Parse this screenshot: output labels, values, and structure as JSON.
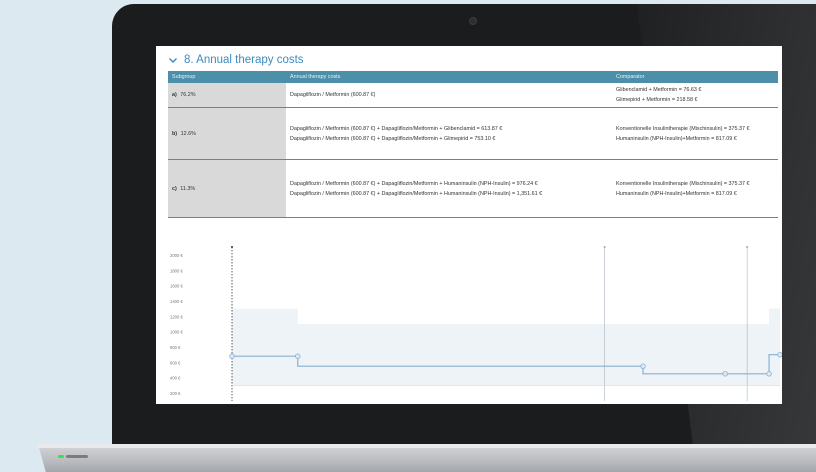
{
  "section": {
    "title": "8. Annual therapy costs",
    "chevron_icon": "chevron-down-icon"
  },
  "table": {
    "headers": [
      "Subgroup",
      "Annual therapy costs",
      "Comparator"
    ],
    "rows": [
      {
        "label": "a)",
        "percent": "76.2%",
        "costs": [
          "Dapagliflozin / Metformin (600.87 €)"
        ],
        "comparator": [
          "Glibenclamid + Metformin = 76.63 €",
          "Glimepirid + Metformin = 218.58 €"
        ]
      },
      {
        "label": "b)",
        "percent": "12.6%",
        "costs": [
          "Dapagliflozin / Metformin (600.87 €) + Dapagliflozin/Metformin + Glibenclamid = 613.87 €",
          "Dapagliflozin / Metformin (600.87 €) + Dapagliflozin/Metformin + Glimepirid = 753.10 €"
        ],
        "comparator": [
          "Konventionelle Insulintherapie (Mischinsulin) = 375.37 €",
          "Humaninsulin (NPH-Insulin)+Metformin = 817.09 €"
        ]
      },
      {
        "label": "c)",
        "percent": "11.3%",
        "costs": [
          "Dapagliflozin / Metformin (600.87 €) + Dapagliflozin/Metformin + Humaninsulin (NPH-Insulin) = 976.24 €",
          "Dapagliflozin / Metformin (600.87 €) + Dapagliflozin/Metformin + Humaninsulin (NPH-Insulin) = 1,351.61 €"
        ],
        "comparator": [
          "Konventionelle Insulintherapie (Mischinsulin) = 375.37 €",
          "Humaninsulin (NPH-Insulin)+Metformin = 817.09 €"
        ]
      }
    ]
  },
  "chart_data": {
    "type": "line",
    "y_ticks": [
      "2000 €",
      "1800 €",
      "1600 €",
      "1400 €",
      "1200 €",
      "1000 €",
      "800 €",
      "600 €",
      "400 €",
      "200 €"
    ],
    "ylim": [
      200,
      2000
    ],
    "xlim": [
      0,
      100
    ],
    "series": [
      {
        "name": "",
        "points": [
          [
            0,
            680
          ],
          [
            12,
            680
          ],
          [
            12,
            550
          ],
          [
            75,
            550
          ],
          [
            75,
            450
          ],
          [
            90,
            450
          ],
          [
            98,
            450
          ],
          [
            98,
            700
          ],
          [
            100,
            700
          ]
        ]
      }
    ],
    "band": {
      "upper": [
        [
          0,
          1300
        ],
        [
          12,
          1300
        ],
        [
          12,
          1100
        ],
        [
          98,
          1100
        ],
        [
          98,
          1300
        ],
        [
          100,
          1300
        ]
      ],
      "lower": [
        [
          0,
          300
        ],
        [
          100,
          300
        ]
      ]
    },
    "vertical_markers_x": [
      0,
      68,
      94
    ],
    "grid": false,
    "colors": {
      "line": "#8ab0d0",
      "band": "#eef3f8",
      "marker": "#9aa6b0",
      "axis": "#333333"
    }
  },
  "theme": {
    "accent": "#4c8fa9",
    "title": "#3a8bbf"
  }
}
